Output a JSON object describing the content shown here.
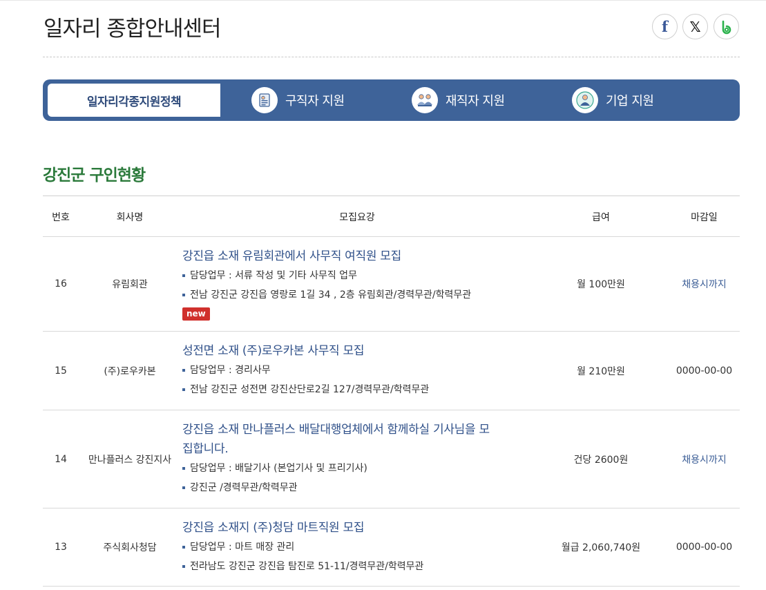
{
  "page": {
    "title": "일자리 종합안내센터"
  },
  "share": {
    "facebook_icon": "facebook-icon",
    "x_icon": "x-icon",
    "band_icon": "band-icon"
  },
  "tabs": [
    {
      "label": "일자리각종지원정책",
      "active": true
    },
    {
      "label": "구직자 지원",
      "icon": "jobseeker-icon"
    },
    {
      "label": "재직자 지원",
      "icon": "employee-icon"
    },
    {
      "label": "기업 지원",
      "icon": "company-icon"
    }
  ],
  "section": {
    "title": "강진군 구인현황"
  },
  "table": {
    "headers": {
      "no": "번호",
      "company": "회사명",
      "requirements": "모집요강",
      "salary": "급여",
      "deadline": "마감일"
    },
    "rows": [
      {
        "no": "16",
        "company": "유림회관",
        "title": "강진읍 소재 유림회관에서 사무직 여직원 모집",
        "duty": "담당업무 : 서류 작성 및 기타 사무직 업무",
        "location": "전남 강진군 강진읍 영랑로 1길 34 , 2층 유림회관/경력무관/학력무관",
        "badge": "new",
        "salary": "월 100만원",
        "deadline": "채용시까지"
      },
      {
        "no": "15",
        "company": "(주)로우카본",
        "title": "성전면 소재 (주)로우카본 사무직 모집",
        "duty": "담당업무 : 경리사무",
        "location": "전남 강진군 성전면 강진산단로2길 127/경력무관/학력무관",
        "salary": "월 210만원",
        "deadline": "0000-00-00"
      },
      {
        "no": "14",
        "company": "만나플러스 강진지사",
        "title_line1": "강진읍 소재 만나플러스 배달대행업체에서 함께하실 기사님을 모",
        "title_line2": "집합니다.",
        "duty": "담당업무 : 배달기사 (본업기사 및 프리기사)",
        "location": "강진군 /경력무관/학력무관",
        "salary": "건당 2600원",
        "deadline": "채용시까지"
      },
      {
        "no": "13",
        "company": "주식회사청담",
        "title": "강진읍 소재지 (주)청담 마트직원 모집",
        "duty": "담당업무 : 마트 매장 관리",
        "location": "전라남도 강진군 강진읍 탐진로 51-11/경력무관/학력무관",
        "salary": "월급 2,060,740원",
        "deadline": "0000-00-00"
      }
    ]
  }
}
